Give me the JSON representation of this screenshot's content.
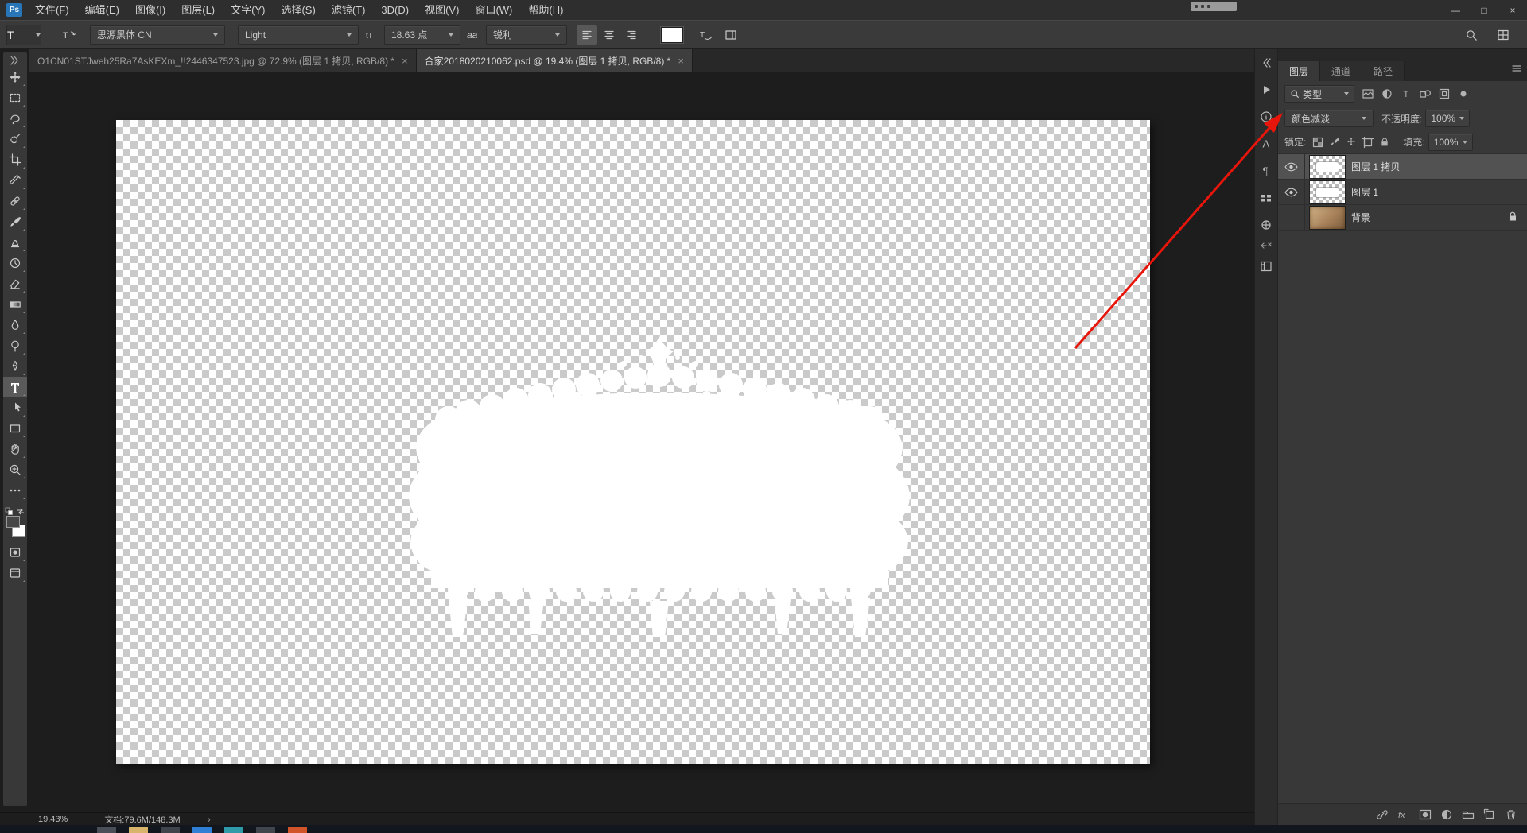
{
  "titlebar": {
    "logo": "Ps",
    "menus": [
      "文件(F)",
      "编辑(E)",
      "图像(I)",
      "图层(L)",
      "文字(Y)",
      "选择(S)",
      "滤镜(T)",
      "3D(D)",
      "视图(V)",
      "窗口(W)",
      "帮助(H)"
    ],
    "window_controls": [
      {
        "name": "minimize-button",
        "glyph": "—"
      },
      {
        "name": "maximize-button",
        "glyph": "□"
      },
      {
        "name": "close-button",
        "glyph": "×"
      }
    ]
  },
  "options_bar": {
    "tool_glyph": "T",
    "font_family": "思源黑体 CN",
    "font_style": "Light",
    "font_size": "18.63 点",
    "anti_alias": "锐利",
    "text_color": "#ffffff",
    "align_icons": [
      {
        "name": "align-left-icon",
        "icon": "alignleft",
        "active": true
      },
      {
        "name": "align-center-icon",
        "icon": "aligncenter",
        "active": false
      },
      {
        "name": "align-right-icon",
        "icon": "alignright",
        "active": false
      }
    ],
    "right_icons": [
      {
        "name": "search-icon",
        "icon": "search"
      },
      {
        "name": "workspace-switcher-icon",
        "icon": "grid3"
      }
    ]
  },
  "tabs": [
    {
      "title": "O1CN01STJweh25Ra7AsKEXm_!!2446347523.jpg @ 72.9% (图层 1 拷贝, RGB/8) *",
      "active": false,
      "close_glyph": "×"
    },
    {
      "title": "合家2018020210062.psd @ 19.4% (图层 1 拷贝, RGB/8) *",
      "active": true,
      "close_glyph": "×"
    }
  ],
  "tools": [
    {
      "name": "move-tool",
      "icon": "move"
    },
    {
      "name": "marquee-tool",
      "icon": "marquee"
    },
    {
      "name": "lasso-tool",
      "icon": "lasso"
    },
    {
      "name": "quick-selection-tool",
      "icon": "quickselect"
    },
    {
      "name": "crop-tool",
      "icon": "crop"
    },
    {
      "name": "eyedropper-tool",
      "icon": "eyedropper"
    },
    {
      "name": "healing-brush-tool",
      "icon": "healing"
    },
    {
      "name": "brush-tool",
      "icon": "brush"
    },
    {
      "name": "clone-stamp-tool",
      "icon": "stamp"
    },
    {
      "name": "history-brush-tool",
      "icon": "historybrush"
    },
    {
      "name": "eraser-tool",
      "icon": "eraser"
    },
    {
      "name": "gradient-tool",
      "icon": "gradient"
    },
    {
      "name": "blur-tool",
      "icon": "blur"
    },
    {
      "name": "dodge-tool",
      "icon": "dodge"
    },
    {
      "name": "pen-tool",
      "icon": "pen"
    },
    {
      "name": "type-tool",
      "icon": "type",
      "active": true
    },
    {
      "name": "path-selection-tool",
      "icon": "pathselect"
    },
    {
      "name": "shape-tool",
      "icon": "shape"
    },
    {
      "name": "hand-tool",
      "icon": "hand"
    },
    {
      "name": "zoom-tool",
      "icon": "zoom"
    },
    {
      "name": "edit-toolbar-button",
      "icon": "ellipsis"
    }
  ],
  "color_swatches": {
    "foreground": "#474747",
    "background": "#ffffff"
  },
  "dock_icons": [
    {
      "name": "expand-panels-icon",
      "icon": "chevleft2"
    },
    {
      "name": "properties-panel-icon",
      "icon": "play"
    },
    {
      "name": "info-panel-icon",
      "icon": "info"
    },
    {
      "name": "character-panel-icon",
      "icon": "charA"
    },
    {
      "name": "paragraph-panel-icon",
      "icon": "para"
    },
    {
      "name": "swatches-panel-icon",
      "icon": "swatchgrid"
    },
    {
      "name": "clone-source-panel-icon",
      "icon": "clonesrc"
    },
    {
      "name": "dock-group-close-icon",
      "icon": "dockx",
      "small": true
    },
    {
      "name": "brush-settings-panel-icon",
      "icon": "brushpanel"
    }
  ],
  "layers_panel": {
    "tabs": [
      {
        "label": "图层",
        "active": true
      },
      {
        "label": "通道",
        "active": false
      },
      {
        "label": "路径",
        "active": false
      }
    ],
    "filter_label": "类型",
    "filter_icons": [
      {
        "name": "filter-pixel-layers-icon",
        "icon": "pix"
      },
      {
        "name": "filter-adjustment-layers-icon",
        "icon": "halfcircle"
      },
      {
        "name": "filter-type-layers-icon",
        "icon": "typeT"
      },
      {
        "name": "filter-shape-layers-icon",
        "icon": "shapes"
      },
      {
        "name": "filter-smart-objects-icon",
        "icon": "smartobj"
      },
      {
        "name": "filter-toggle-icon",
        "icon": "dot"
      }
    ],
    "blend_mode": "颜色减淡",
    "opacity_label": "不透明度:",
    "opacity_value": "100%",
    "lock_label": "锁定:",
    "lock_icons": [
      {
        "name": "lock-transparent-pixels-icon",
        "icon": "checker"
      },
      {
        "name": "lock-image-pixels-icon",
        "icon": "brushsmall"
      },
      {
        "name": "lock-position-icon",
        "icon": "movesmall"
      },
      {
        "name": "lock-artboard-icon",
        "icon": "artboard"
      },
      {
        "name": "lock-all-icon",
        "icon": "locksmall"
      }
    ],
    "fill_label": "填充:",
    "fill_value": "100%",
    "layers": [
      {
        "name": "图层 1 拷贝",
        "visible": true,
        "selected": true,
        "thumb": "transparent",
        "locked": false
      },
      {
        "name": "图层 1",
        "visible": true,
        "selected": false,
        "thumb": "transparent",
        "locked": false
      },
      {
        "name": "背景",
        "visible": false,
        "selected": false,
        "thumb": "photo",
        "locked": true
      }
    ],
    "footer_icons": [
      {
        "name": "link-layers-icon",
        "icon": "chain"
      },
      {
        "name": "layer-style-icon",
        "icon": "fx"
      },
      {
        "name": "add-layer-mask-icon",
        "icon": "mask"
      },
      {
        "name": "new-adjustment-layer-icon",
        "icon": "adjust"
      },
      {
        "name": "new-group-icon",
        "icon": "folder"
      },
      {
        "name": "new-layer-icon",
        "icon": "newlayer"
      },
      {
        "name": "delete-layer-icon",
        "icon": "trash"
      }
    ]
  },
  "status_bar": {
    "zoom": "19.43%",
    "doc_info": "文档:79.6M/148.3M",
    "chevron": "›"
  },
  "annotation": {
    "type": "arrow",
    "color": "#e8150b"
  },
  "taskbar": {
    "icons": [
      {
        "name": "taskbar-app-1",
        "color": "#4a4f57"
      },
      {
        "name": "taskbar-app-2",
        "color": "#d8b56a"
      },
      {
        "name": "taskbar-app-3",
        "color": "#40454c"
      },
      {
        "name": "taskbar-app-4",
        "color": "#2f7fd4"
      },
      {
        "name": "taskbar-app-5",
        "color": "#2f9ba8"
      },
      {
        "name": "taskbar-app-6",
        "color": "#41464d"
      },
      {
        "name": "taskbar-app-7",
        "color": "#d2552a"
      }
    ]
  }
}
